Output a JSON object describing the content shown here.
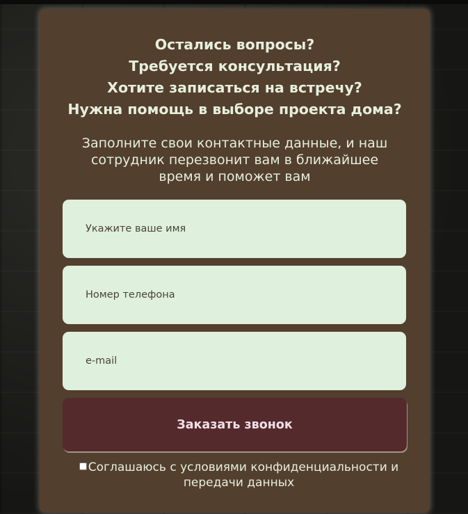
{
  "form": {
    "headline": [
      "Остались вопросы?",
      "Требуется консультация?",
      "Хотите записаться на встречу?",
      "Нужна помощь в выборе проекта дома?"
    ],
    "subtitle": "Заполните свои контактные данные, и наш сотрудник перезвонит вам в ближайшее время и поможет вам",
    "name_placeholder": "Укажите ваше имя",
    "phone_placeholder": "Номер телефона",
    "email_placeholder": "e-mail",
    "submit_label": "Заказать звонок",
    "consent_label": "Соглашаюсь с условиями конфиденциальности и передачи данных",
    "consent_checked": false
  },
  "colors": {
    "card_bg": "#533f2e",
    "input_bg": "#dff0dd",
    "button_bg": "#542a2c",
    "text_light": "#e6efdd",
    "button_text": "#f2dfe8"
  }
}
